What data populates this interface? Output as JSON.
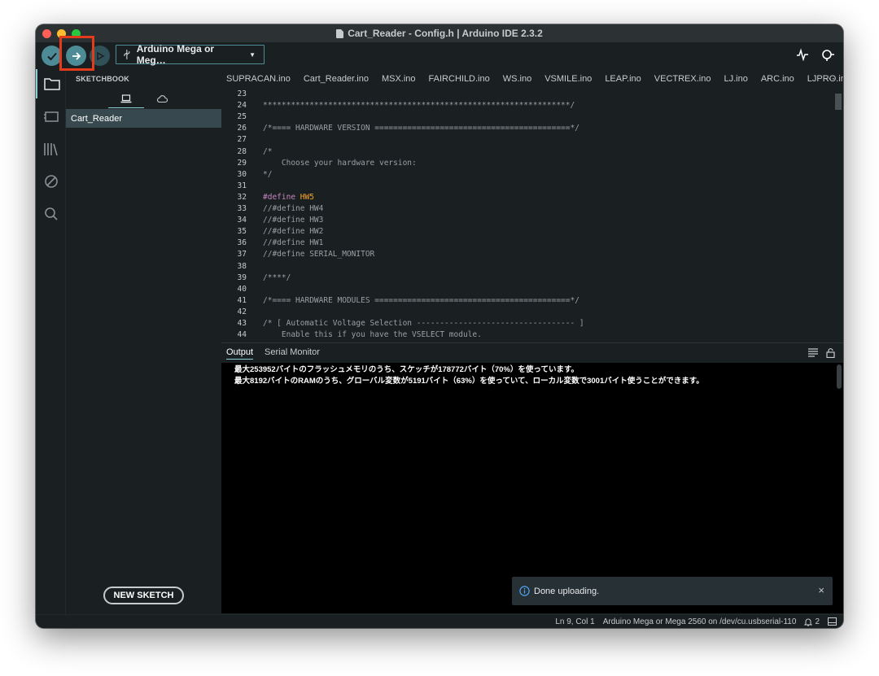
{
  "window": {
    "title": "Cart_Reader - Config.h | Arduino IDE 2.3.2"
  },
  "toolbar": {
    "board": "Arduino Mega or Meg…"
  },
  "sidebar": {
    "header": "SKETCHBOOK",
    "items": [
      "Cart_Reader"
    ],
    "new_sketch": "NEW SKETCH"
  },
  "tabs": [
    "SUPRACAN.ino",
    "Cart_Reader.ino",
    "MSX.ino",
    "FAIRCHILD.ino",
    "WS.ino",
    "VSMILE.ino",
    "LEAP.ino",
    "VECTREX.ino",
    "LJ.ino",
    "ARC.ino",
    "LJPRO.ino"
  ],
  "tabs_more": "⋯",
  "editor": {
    "lines": [
      {
        "n": "23",
        "t": ""
      },
      {
        "n": "24",
        "t": "******************************************************************/"
      },
      {
        "n": "25",
        "t": ""
      },
      {
        "n": "26",
        "t": "/*==== HARDWARE VERSION ==========================================*/"
      },
      {
        "n": "27",
        "t": ""
      },
      {
        "n": "28",
        "t": "/*"
      },
      {
        "n": "29",
        "t": "    Choose your hardware version:"
      },
      {
        "n": "30",
        "t": "*/"
      },
      {
        "n": "31",
        "t": ""
      },
      {
        "n": "32",
        "kw": "#define",
        "def": " HW5"
      },
      {
        "n": "33",
        "t": "//#define HW4"
      },
      {
        "n": "34",
        "t": "//#define HW3"
      },
      {
        "n": "35",
        "t": "//#define HW2"
      },
      {
        "n": "36",
        "t": "//#define HW1"
      },
      {
        "n": "37",
        "t": "//#define SERIAL_MONITOR"
      },
      {
        "n": "38",
        "t": ""
      },
      {
        "n": "39",
        "t": "/****/"
      },
      {
        "n": "40",
        "t": ""
      },
      {
        "n": "41",
        "t": "/*==== HARDWARE MODULES ==========================================*/"
      },
      {
        "n": "42",
        "t": ""
      },
      {
        "n": "43",
        "t": "/* [ Automatic Voltage Selection ---------------------------------- ]"
      },
      {
        "n": "44",
        "t": "    Enable this if you have the VSELECT module."
      }
    ]
  },
  "panel": {
    "tabs": [
      "Output",
      "Serial Monitor"
    ],
    "output_lines": [
      "最大253952バイトのフラッシュメモリのうち、スケッチが178772バイト（70%）を使っています。",
      "最大8192バイトのRAMのうち、グローバル変数が5191バイト（63%）を使っていて、ローカル変数で3001バイト使うことができます。"
    ]
  },
  "toast": {
    "message": "Done uploading.",
    "close": "×"
  },
  "status": {
    "position": "Ln 9, Col 1",
    "board_port": "Arduino Mega or Mega 2560 on /dev/cu.usbserial-110",
    "notifications": "2"
  }
}
